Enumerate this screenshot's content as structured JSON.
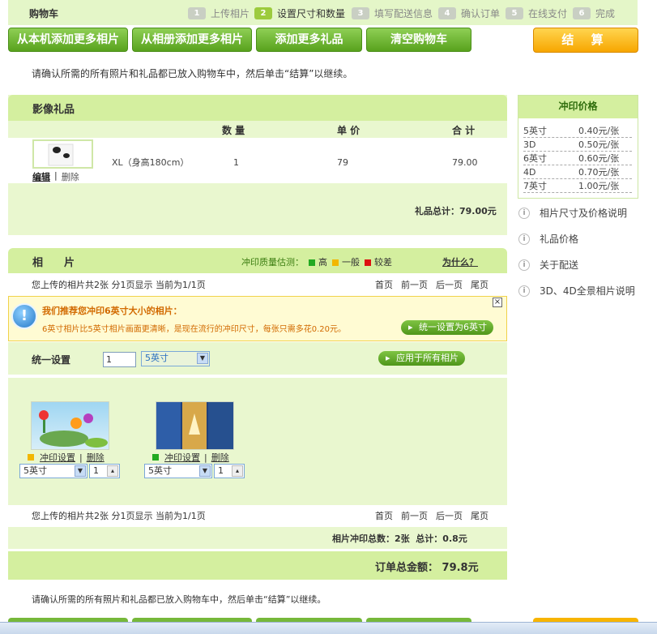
{
  "header": {
    "title": "购物车",
    "steps": [
      {
        "num": "1",
        "label": "上传相片"
      },
      {
        "num": "2",
        "label": "设置尺寸和数量"
      },
      {
        "num": "3",
        "label": "填写配送信息"
      },
      {
        "num": "4",
        "label": "确认订单"
      },
      {
        "num": "5",
        "label": "在线支付"
      },
      {
        "num": "6",
        "label": "完成"
      }
    ]
  },
  "toolbar": {
    "add_local": "从本机添加更多相片",
    "add_album": "从相册添加更多相片",
    "add_gift": "添加更多礼品",
    "clear_cart": "清空购物车",
    "checkout": "结 算"
  },
  "notice": "请确认所需的所有照片和礼品都已放入购物车中，然后单击“结算”以继续。",
  "gifts": {
    "title": "影像礼品",
    "headers": {
      "qty": "数 量",
      "unit": "单 价",
      "total": "合 计"
    },
    "item": {
      "name": "XL（身高180cm）",
      "qty": "1",
      "unit": "79",
      "total": "79.00",
      "edit": "编辑",
      "sep": "|",
      "delete": "删除"
    },
    "subtotal": "礼品总计：79.00元"
  },
  "photos": {
    "title": "相　　片",
    "quality_label": "冲印质量估测：",
    "quality": [
      {
        "label": "高",
        "color": "#22aa22"
      },
      {
        "label": "一般",
        "color": "#f2b700"
      },
      {
        "label": "较差",
        "color": "#dd1111"
      }
    ],
    "why": "为什么？",
    "pager_text": "您上传的相片共2张 分1页显示 当前为1/1页",
    "pager": {
      "first": "首页",
      "prev": "前一页",
      "next": "后一页",
      "last": "尾页"
    },
    "recommend_title": "我们推荐您冲印6英寸大小的相片：",
    "recommend_text": "6英寸相片比5英寸相片画面更清晰，是现在流行的冲印尺寸，每张只需多花0.20元。",
    "recommend_btn": "统一设置为6英寸",
    "unify_label": "统一设置",
    "unify_qty": "1",
    "unify_size": "5英寸",
    "apply_all": "应用于所有相片",
    "items": [
      {
        "settings": "冲印设置",
        "sep": "|",
        "delete": "删除",
        "size": "5英寸",
        "qty": "1",
        "status_color": "#f2b700"
      },
      {
        "settings": "冲印设置",
        "sep": "|",
        "delete": "删除",
        "size": "5英寸",
        "qty": "1",
        "status_color": "#22aa22"
      }
    ],
    "summary": "相片冲印总数：2张  总计：0.8元"
  },
  "order_total": "订单总金额： 79.8元",
  "sidebar": {
    "price_title": "冲印价格",
    "prices": [
      {
        "size": "5英寸",
        "price": "0.40元/张"
      },
      {
        "size": "3D",
        "price": "0.50元/张"
      },
      {
        "size": "6英寸",
        "price": "0.60元/张"
      },
      {
        "size": "4D",
        "price": "0.70元/张"
      },
      {
        "size": "7英寸",
        "price": "1.00元/张"
      }
    ],
    "links": [
      "相片尺寸及价格说明",
      "礼品价格",
      "关于配送",
      "3D、4D全景相片说明"
    ]
  }
}
